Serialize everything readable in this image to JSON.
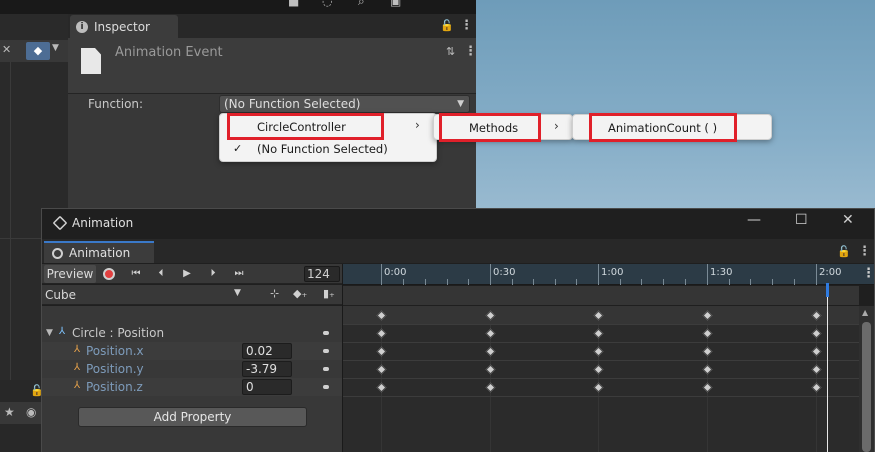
{
  "inspector": {
    "tab_label": "Inspector",
    "title": "Animation Event",
    "function_label": "Function:",
    "function_value": "(No Function Selected)"
  },
  "menu": {
    "level1": [
      {
        "label": "CircleController",
        "submenu": true
      },
      {
        "label": "(No Function Selected)",
        "checked": true
      }
    ],
    "level2": [
      {
        "label": "Methods",
        "submenu": true
      }
    ],
    "level3": [
      {
        "label": "AnimationCount ( )"
      }
    ],
    "check_glyph": "✓",
    "chevron_glyph": "›",
    "highlight_color": "#e0202a"
  },
  "animation": {
    "window_title": "Animation",
    "tab_label": "Animation",
    "preview_label": "Preview",
    "frame": "124",
    "clip": "Cube",
    "timeline_labels": [
      "0:00",
      "0:30",
      "1:00",
      "1:30",
      "2:00"
    ],
    "group_label": "Circle : Position",
    "properties": [
      {
        "name": "Position.x",
        "value": "0.02"
      },
      {
        "name": "Position.y",
        "value": "-3.79"
      },
      {
        "name": "Position.z",
        "value": "0"
      }
    ],
    "add_property_label": "Add Property",
    "accent_color": "#3a79c9"
  },
  "icons": {
    "lock": "🔓",
    "kebab": "⋮",
    "close": "✕",
    "maximize": "☐",
    "minimize": "—",
    "first": "⏮",
    "prev": "⏴",
    "play": "▶",
    "next": "⏵",
    "last": "⏭"
  }
}
